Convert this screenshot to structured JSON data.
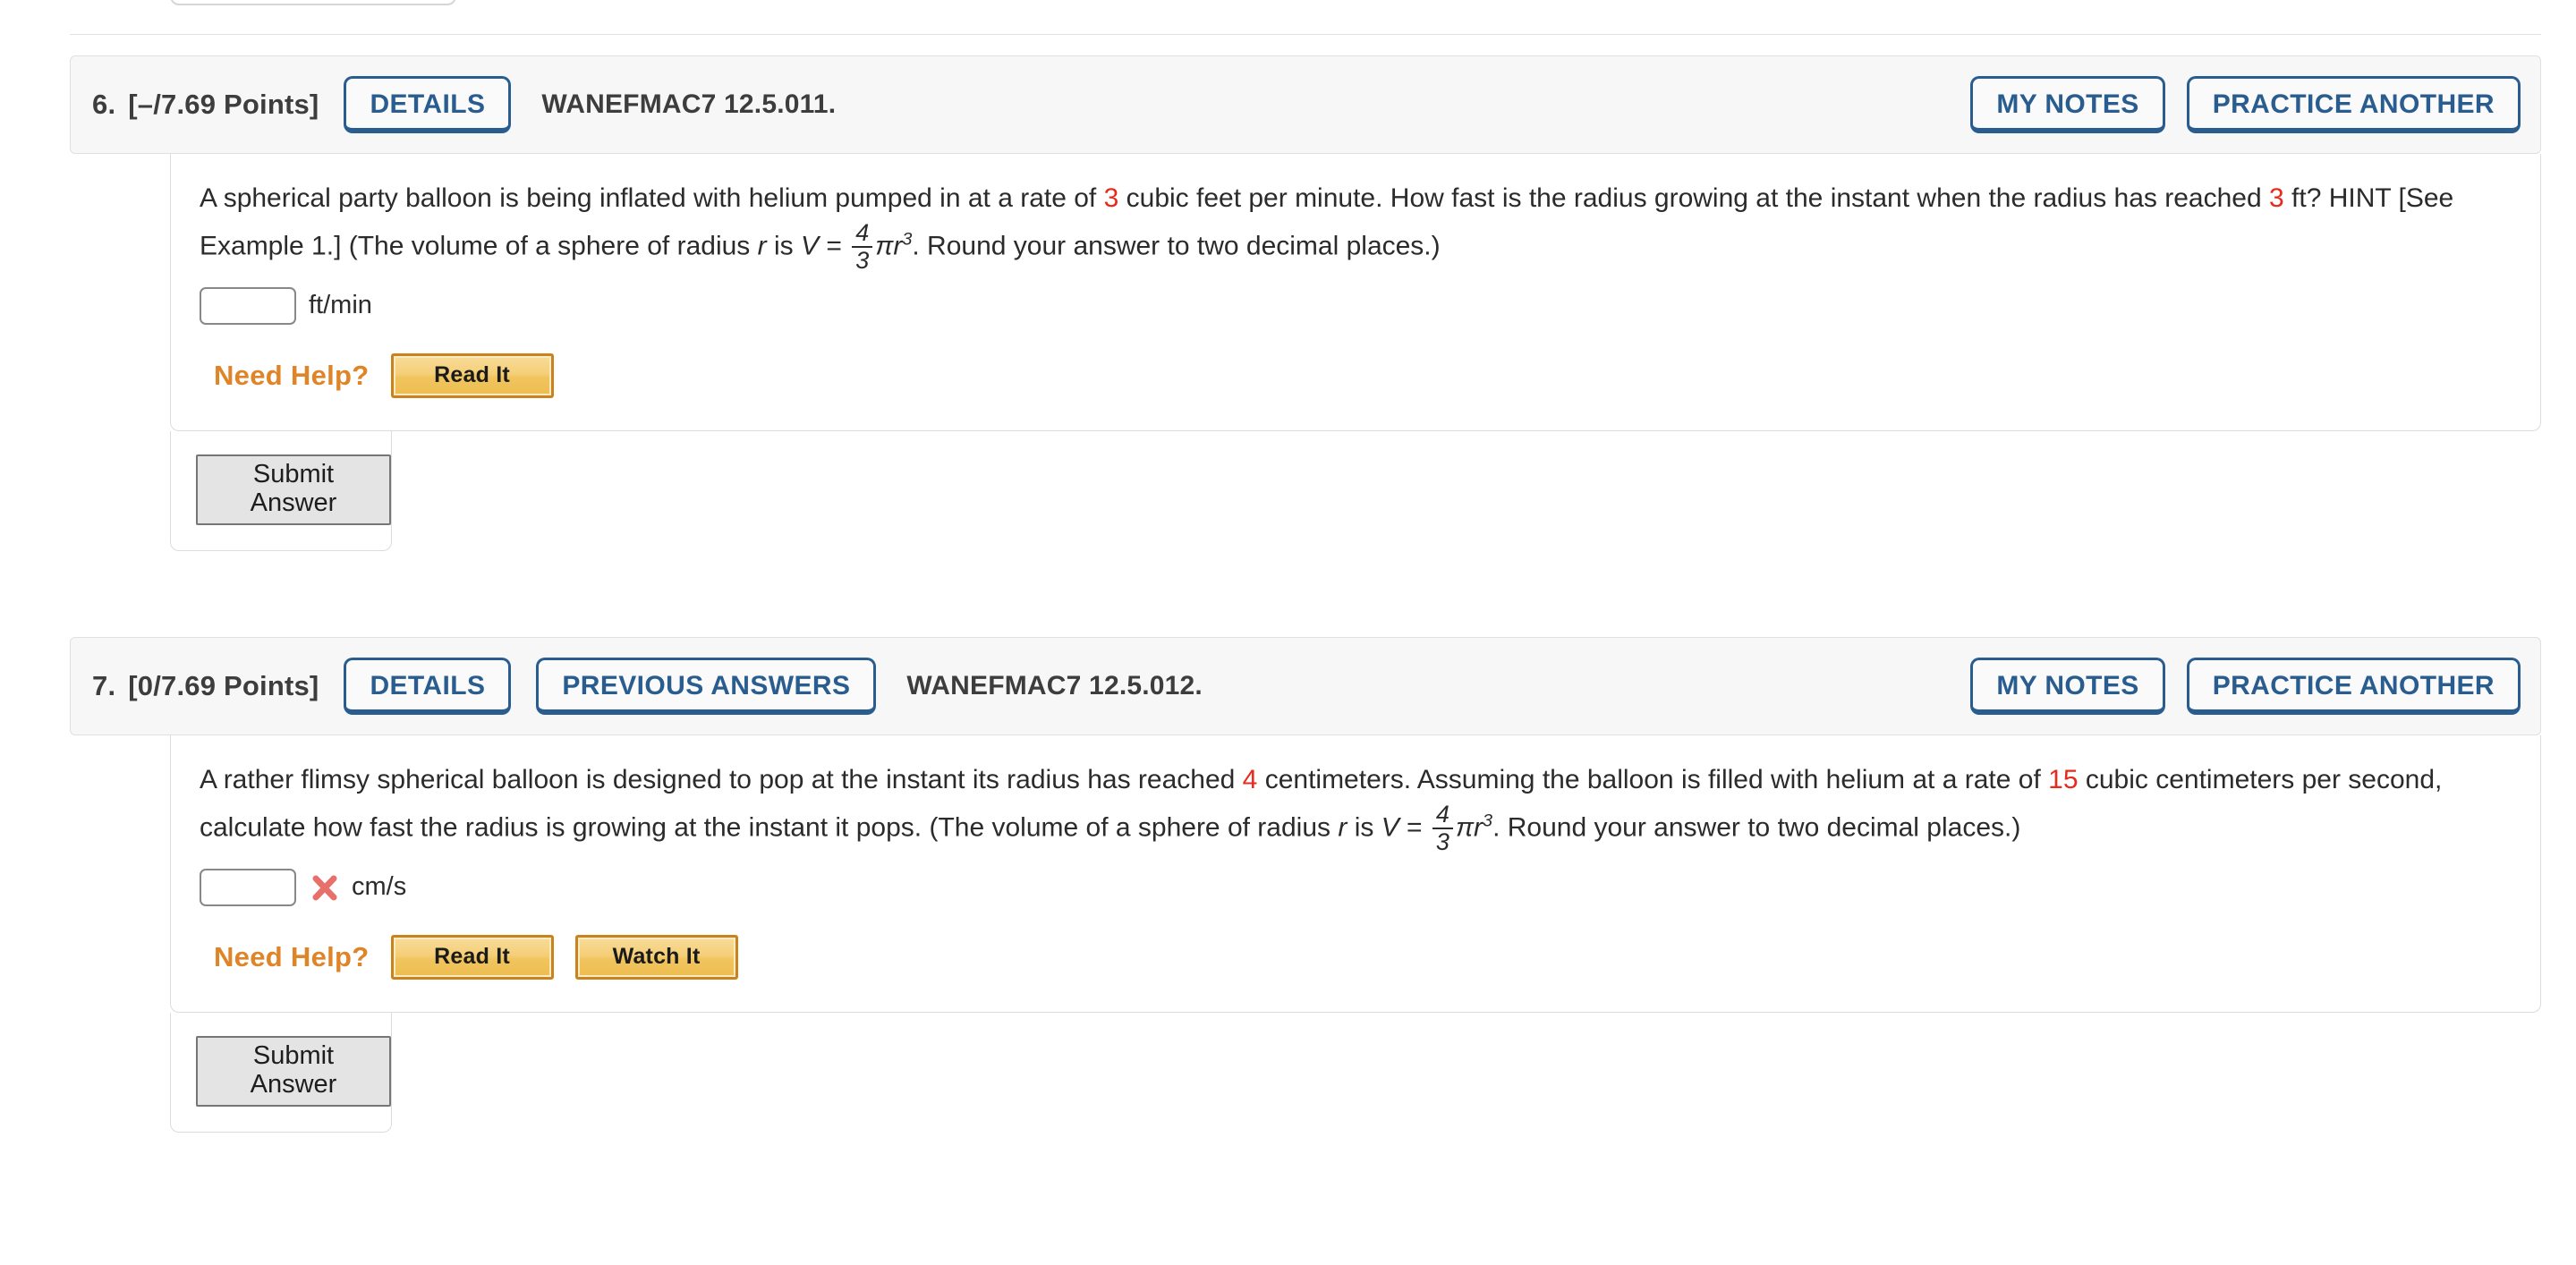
{
  "questions": [
    {
      "number": "6.",
      "points": "[–/7.69 Points]",
      "details_label": "DETAILS",
      "code": "WANEFMAC7 12.5.011.",
      "my_notes_label": "MY NOTES",
      "practice_another_label": "PRACTICE ANOTHER",
      "text": {
        "p1": "A spherical party balloon is being inflated with helium pumped in at a rate of ",
        "v1": "3",
        "p2": " cubic feet per minute. How fast is the radius growing at the instant when the radius has reached ",
        "v2": "3",
        "p3": " ft? HINT [See Example 1.] (The volume of a sphere of radius ",
        "var_r": "r",
        "p4": " is ",
        "var_v": "V",
        "eq": " = ",
        "frac_n": "4",
        "frac_d": "3",
        "pi_r": "πr",
        "exp": "3",
        "p5": ". Round your answer to two decimal places.)"
      },
      "answer": {
        "value": "",
        "units": "ft/min",
        "status": "none"
      },
      "need_help_label": "Need Help?",
      "help_buttons": [
        "Read It"
      ],
      "submit_label": "Submit Answer"
    },
    {
      "number": "7.",
      "points": "[0/7.69 Points]",
      "details_label": "DETAILS",
      "previous_answers_label": "PREVIOUS ANSWERS",
      "code": "WANEFMAC7 12.5.012.",
      "my_notes_label": "MY NOTES",
      "practice_another_label": "PRACTICE ANOTHER",
      "text": {
        "p1": "A rather flimsy spherical balloon is designed to pop at the instant its radius has reached ",
        "v1": "4",
        "p2": " centimeters. Assuming the balloon is filled with helium at a rate of ",
        "v2": "15",
        "p3": " cubic centimeters per second, calculate how fast the radius is growing at the instant it pops. (The volume of a sphere of radius ",
        "var_r": "r",
        "p4": " is ",
        "var_v": "V",
        "eq": " = ",
        "frac_n": "4",
        "frac_d": "3",
        "pi_r": "πr",
        "exp": "3",
        "p5": ". Round your answer to two decimal places.)"
      },
      "answer": {
        "value": "",
        "units": "cm/s",
        "status": "incorrect"
      },
      "need_help_label": "Need Help?",
      "help_buttons": [
        "Read It",
        "Watch It"
      ],
      "submit_label": "Submit Answer"
    }
  ],
  "colors": {
    "accent_blue": "#2a5d8f",
    "help_orange": "#e08428",
    "value_red": "#e8291c",
    "incorrect_red": "#e8706a",
    "header_bg": "#f7f7f7"
  },
  "icons": {
    "incorrect": "x-mark-icon"
  }
}
